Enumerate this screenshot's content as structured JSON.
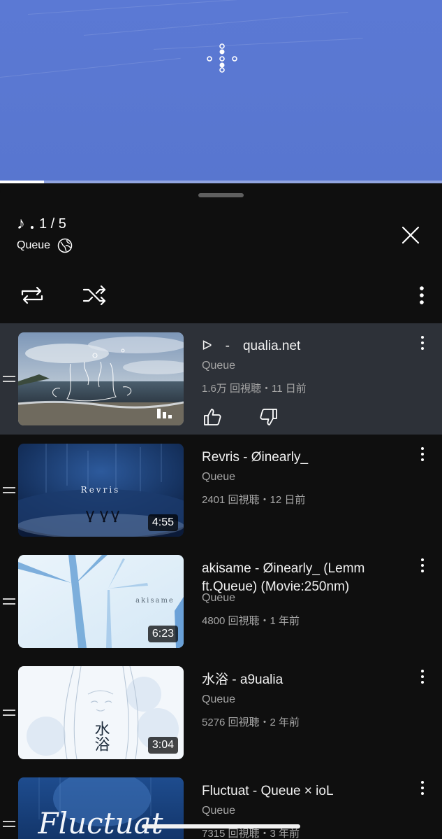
{
  "video": {
    "progress_fraction": 0.1
  },
  "sheet": {
    "position": "1 / 5",
    "queue_label": "Queue",
    "icons": {
      "note": "music-note-icon",
      "globe": "globe-icon",
      "close": "close-icon",
      "repeat": "repeat-icon",
      "shuffle": "shuffle-icon",
      "more": "more-vert-icon"
    }
  },
  "items": [
    {
      "title": "ᐅ　-　qualia.net",
      "channel": "Queue",
      "meta": "1.6万 回視聴・11 日前",
      "duration": "",
      "active": true
    },
    {
      "title": "Revris - Øinearly_",
      "channel": "Queue",
      "meta": "2401 回視聴・12 日前",
      "duration": "4:55",
      "active": false
    },
    {
      "title": "akisame - Øinearly_ (Lemm ft.Queue) (Movie:250nm)",
      "channel": "Queue",
      "meta": "4800 回視聴・1 年前",
      "duration": "6:23",
      "active": false
    },
    {
      "title": "水浴 - a9ualia",
      "channel": "Queue",
      "meta": "5276 回視聴・2 年前",
      "duration": "3:04",
      "active": false
    },
    {
      "title": "Fluctuat - Queue × ioL",
      "channel": "Queue",
      "meta": "7315 回視聴・3 年前",
      "duration": "",
      "active": false
    }
  ],
  "thumb_texts": {
    "revris": "Revris",
    "akisame": "akisame",
    "mizuyoku": "水浴",
    "fluctuat": "Fluctuat"
  },
  "colors": {
    "active_row": "#2d3138",
    "background": "#0f0f0f",
    "video_bg": "#5a78d2"
  }
}
